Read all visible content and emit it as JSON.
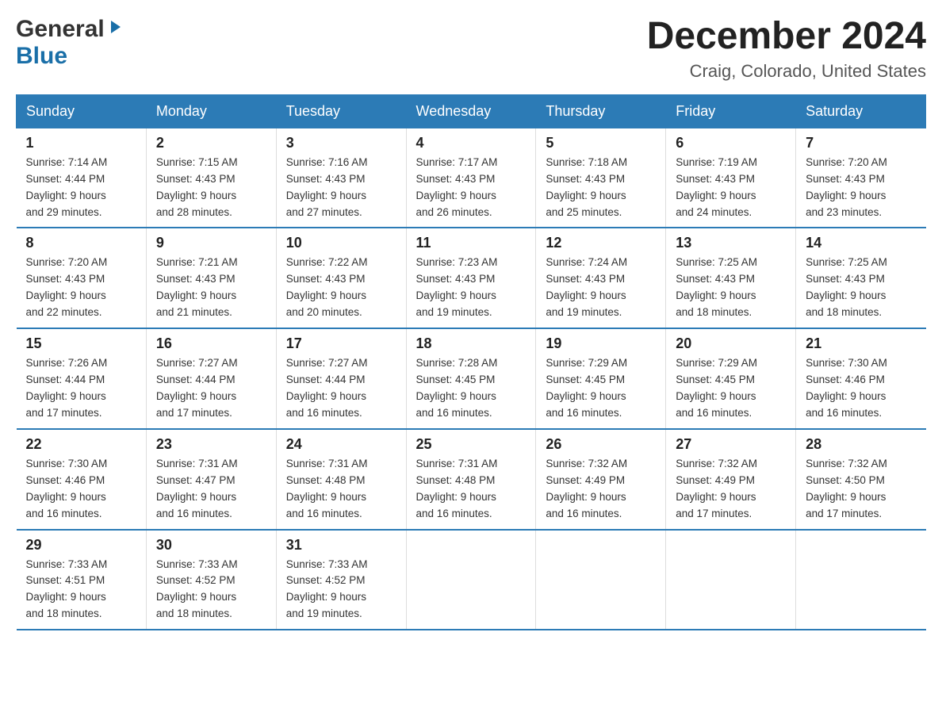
{
  "logo": {
    "general": "General",
    "arrow": "▶",
    "blue": "Blue"
  },
  "title": "December 2024",
  "location": "Craig, Colorado, United States",
  "days_of_week": [
    "Sunday",
    "Monday",
    "Tuesday",
    "Wednesday",
    "Thursday",
    "Friday",
    "Saturday"
  ],
  "weeks": [
    [
      {
        "day": "1",
        "sunrise": "7:14 AM",
        "sunset": "4:44 PM",
        "daylight": "9 hours and 29 minutes."
      },
      {
        "day": "2",
        "sunrise": "7:15 AM",
        "sunset": "4:43 PM",
        "daylight": "9 hours and 28 minutes."
      },
      {
        "day": "3",
        "sunrise": "7:16 AM",
        "sunset": "4:43 PM",
        "daylight": "9 hours and 27 minutes."
      },
      {
        "day": "4",
        "sunrise": "7:17 AM",
        "sunset": "4:43 PM",
        "daylight": "9 hours and 26 minutes."
      },
      {
        "day": "5",
        "sunrise": "7:18 AM",
        "sunset": "4:43 PM",
        "daylight": "9 hours and 25 minutes."
      },
      {
        "day": "6",
        "sunrise": "7:19 AM",
        "sunset": "4:43 PM",
        "daylight": "9 hours and 24 minutes."
      },
      {
        "day": "7",
        "sunrise": "7:20 AM",
        "sunset": "4:43 PM",
        "daylight": "9 hours and 23 minutes."
      }
    ],
    [
      {
        "day": "8",
        "sunrise": "7:20 AM",
        "sunset": "4:43 PM",
        "daylight": "9 hours and 22 minutes."
      },
      {
        "day": "9",
        "sunrise": "7:21 AM",
        "sunset": "4:43 PM",
        "daylight": "9 hours and 21 minutes."
      },
      {
        "day": "10",
        "sunrise": "7:22 AM",
        "sunset": "4:43 PM",
        "daylight": "9 hours and 20 minutes."
      },
      {
        "day": "11",
        "sunrise": "7:23 AM",
        "sunset": "4:43 PM",
        "daylight": "9 hours and 19 minutes."
      },
      {
        "day": "12",
        "sunrise": "7:24 AM",
        "sunset": "4:43 PM",
        "daylight": "9 hours and 19 minutes."
      },
      {
        "day": "13",
        "sunrise": "7:25 AM",
        "sunset": "4:43 PM",
        "daylight": "9 hours and 18 minutes."
      },
      {
        "day": "14",
        "sunrise": "7:25 AM",
        "sunset": "4:43 PM",
        "daylight": "9 hours and 18 minutes."
      }
    ],
    [
      {
        "day": "15",
        "sunrise": "7:26 AM",
        "sunset": "4:44 PM",
        "daylight": "9 hours and 17 minutes."
      },
      {
        "day": "16",
        "sunrise": "7:27 AM",
        "sunset": "4:44 PM",
        "daylight": "9 hours and 17 minutes."
      },
      {
        "day": "17",
        "sunrise": "7:27 AM",
        "sunset": "4:44 PM",
        "daylight": "9 hours and 16 minutes."
      },
      {
        "day": "18",
        "sunrise": "7:28 AM",
        "sunset": "4:45 PM",
        "daylight": "9 hours and 16 minutes."
      },
      {
        "day": "19",
        "sunrise": "7:29 AM",
        "sunset": "4:45 PM",
        "daylight": "9 hours and 16 minutes."
      },
      {
        "day": "20",
        "sunrise": "7:29 AM",
        "sunset": "4:45 PM",
        "daylight": "9 hours and 16 minutes."
      },
      {
        "day": "21",
        "sunrise": "7:30 AM",
        "sunset": "4:46 PM",
        "daylight": "9 hours and 16 minutes."
      }
    ],
    [
      {
        "day": "22",
        "sunrise": "7:30 AM",
        "sunset": "4:46 PM",
        "daylight": "9 hours and 16 minutes."
      },
      {
        "day": "23",
        "sunrise": "7:31 AM",
        "sunset": "4:47 PM",
        "daylight": "9 hours and 16 minutes."
      },
      {
        "day": "24",
        "sunrise": "7:31 AM",
        "sunset": "4:48 PM",
        "daylight": "9 hours and 16 minutes."
      },
      {
        "day": "25",
        "sunrise": "7:31 AM",
        "sunset": "4:48 PM",
        "daylight": "9 hours and 16 minutes."
      },
      {
        "day": "26",
        "sunrise": "7:32 AM",
        "sunset": "4:49 PM",
        "daylight": "9 hours and 16 minutes."
      },
      {
        "day": "27",
        "sunrise": "7:32 AM",
        "sunset": "4:49 PM",
        "daylight": "9 hours and 17 minutes."
      },
      {
        "day": "28",
        "sunrise": "7:32 AM",
        "sunset": "4:50 PM",
        "daylight": "9 hours and 17 minutes."
      }
    ],
    [
      {
        "day": "29",
        "sunrise": "7:33 AM",
        "sunset": "4:51 PM",
        "daylight": "9 hours and 18 minutes."
      },
      {
        "day": "30",
        "sunrise": "7:33 AM",
        "sunset": "4:52 PM",
        "daylight": "9 hours and 18 minutes."
      },
      {
        "day": "31",
        "sunrise": "7:33 AM",
        "sunset": "4:52 PM",
        "daylight": "9 hours and 19 minutes."
      },
      null,
      null,
      null,
      null
    ]
  ],
  "labels": {
    "sunrise": "Sunrise:",
    "sunset": "Sunset:",
    "daylight": "Daylight:"
  }
}
